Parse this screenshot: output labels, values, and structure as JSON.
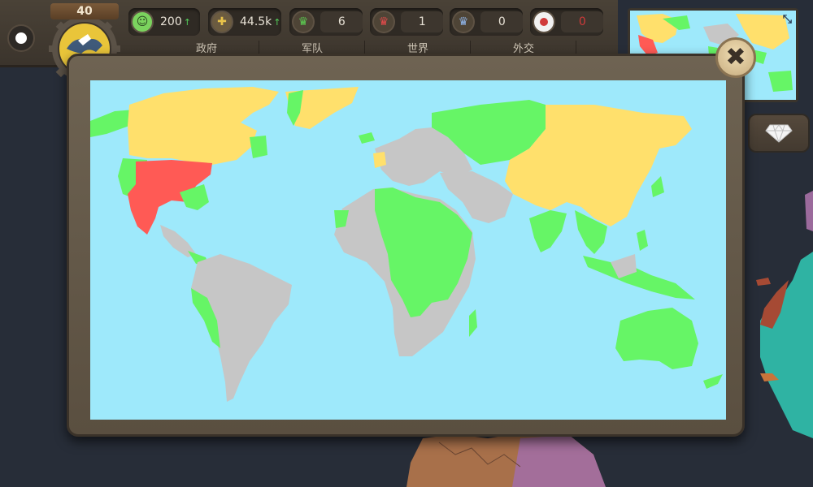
{
  "player": {
    "level": "40"
  },
  "stats": [
    {
      "key": "happiness",
      "icon": "smiley-icon",
      "value": "200",
      "trend": "↑",
      "color": "#7bd35e"
    },
    {
      "key": "gold",
      "icon": "gold-coins-icon",
      "value": "44.5k",
      "trend": "↑",
      "color": "#d9b847"
    },
    {
      "key": "allies",
      "icon": "crown-green-icon",
      "value": "6",
      "trend": "",
      "color": "#5ccb51"
    },
    {
      "key": "enemies",
      "icon": "crown-red-icon",
      "value": "1",
      "trend": "",
      "color": "#e04a4a"
    },
    {
      "key": "neutral",
      "icon": "crown-blue-icon",
      "value": "0",
      "trend": "",
      "color": "#8fb4e8"
    },
    {
      "key": "flag",
      "icon": "japan-flag-icon",
      "value": "0",
      "trend": "",
      "color": "#d03a3a"
    }
  ],
  "tabs": [
    "政府",
    "军队",
    "世界",
    "外交"
  ],
  "modal": {
    "close_label": "✖"
  },
  "map_colors": {
    "ocean": "#9ee9fb",
    "ally": "#66f566",
    "own": "#ffe06c",
    "enemy": "#ff5a55",
    "unclaimed": "#c6c6c6"
  }
}
